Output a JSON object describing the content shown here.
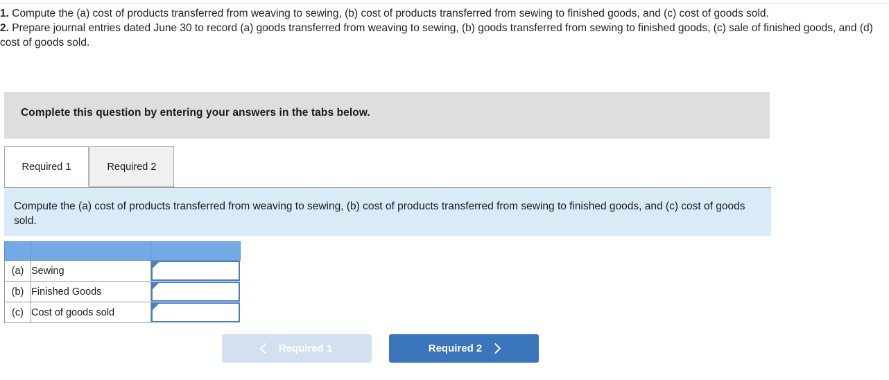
{
  "intro": {
    "item1_num": "1.",
    "item1_text": " Compute the (a) cost of products transferred from weaving to sewing, (b) cost of products transferred from sewing to finished goods, and (c) cost of goods sold.",
    "item2_num": "2.",
    "item2_text": " Prepare journal entries dated June 30 to record (a) goods transferred from weaving to sewing, (b) goods transferred from sewing to finished goods, (c) sale of finished goods, and (d) cost of goods sold."
  },
  "banner": {
    "text": "Complete this question by entering your answers in the tabs below."
  },
  "tabs": [
    {
      "label": "Required 1",
      "active": true
    },
    {
      "label": "Required 2",
      "active": false
    }
  ],
  "info_panel": {
    "text": "Compute the (a) cost of products transferred from weaving to sewing, (b) cost of products transferred from sewing to finished goods, and (c) cost of goods sold."
  },
  "answer_table": {
    "header": {
      "col1": "",
      "col2": "",
      "col3": ""
    },
    "rows": [
      {
        "tag": "(a)",
        "label": "Sewing",
        "value": "",
        "placeholder": ""
      },
      {
        "tag": "(b)",
        "label": "Finished Goods",
        "value": "",
        "placeholder": ""
      },
      {
        "tag": "(c)",
        "label": "Cost of goods sold",
        "value": "",
        "placeholder": ""
      }
    ]
  },
  "nav": {
    "prev_label": "Required 1",
    "next_label": "Required 2"
  },
  "colors": {
    "banner_gray": "#dedede",
    "info_blue": "#daebf8",
    "table_header_blue": "#74aae4",
    "input_border_blue": "#4a80c0",
    "btn_primary": "#3b75bb",
    "btn_disabled": "#d3e0f0"
  }
}
